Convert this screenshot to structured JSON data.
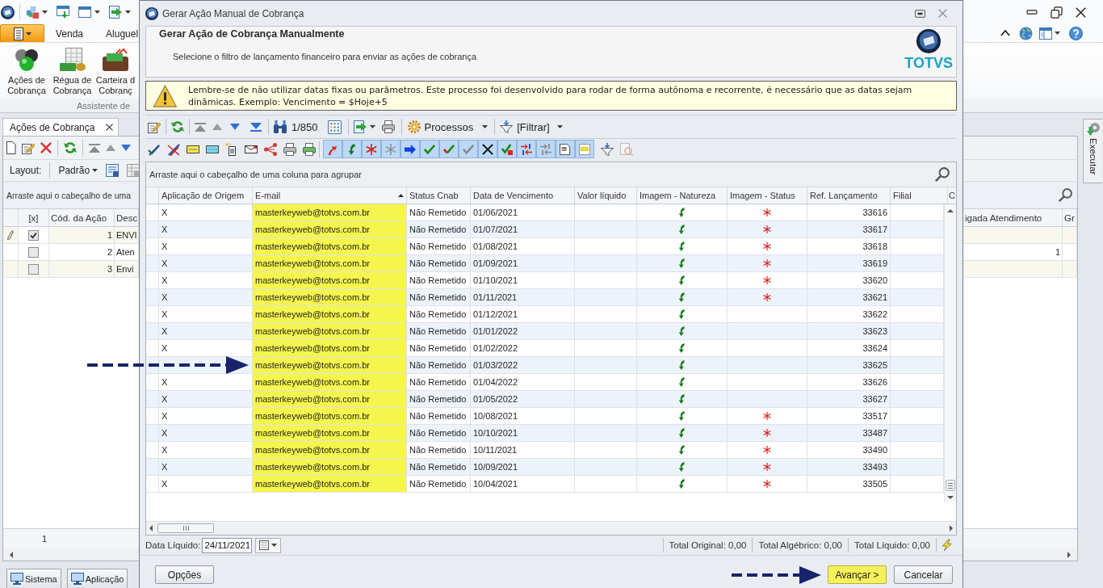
{
  "app": {
    "ribbon_tabs": [
      {
        "label": "Venda",
        "selected": false
      },
      {
        "label": "Aluguel",
        "selected": false
      }
    ],
    "ribbon_buttons": [
      {
        "lines": [
          "Ações de",
          "Cobrança"
        ]
      },
      {
        "lines": [
          "Régua de",
          "Cobrança"
        ]
      },
      {
        "lines": [
          "Carteira d",
          "Cobranç"
        ]
      }
    ],
    "ribbon_group": "Assistente de",
    "document_tabs": [
      {
        "label": "Ações de Cobrança",
        "selected": true
      }
    ],
    "layout": {
      "label": "Layout:",
      "value": "Padrão"
    },
    "grid": {
      "group_hint": "Arraste aqui o cabeçalho de uma",
      "columns": [
        "[x]",
        "Cód. da Ação",
        "Desc",
        "igada Atendimento",
        "Gr"
      ],
      "rows": [
        {
          "focused": true,
          "checked": true,
          "code": "1",
          "description": "ENVI"
        },
        {
          "focused": false,
          "checked": false,
          "code": "2",
          "description": "Aten",
          "coligada": "1"
        },
        {
          "focused": false,
          "checked": false,
          "code": "3",
          "description": "Envi"
        }
      ],
      "footer_count": "1"
    },
    "side_tab": "Executar",
    "taskbar": [
      {
        "label": "Sistema"
      },
      {
        "label": "Aplicação"
      }
    ]
  },
  "dialog": {
    "title": "Gerar Ação Manual de Cobrança",
    "heading": "Gerar Ação de Cobrança Manualmente",
    "subheading": "Selecione o filtro de lançamento financeiro para enviar as ações de cobrança",
    "logo_text": "TOTVS",
    "warning": "Lembre-se de não utilizar datas fixas ou parâmetros. Este processo foi desenvolvido para rodar de forma autônoma e recorrente, é necessário que as datas sejam dinâmicas. Exemplo: Vencimento = $Hoje+5",
    "toolbar": {
      "record_position": "1/850",
      "processes": "Processos",
      "filter": "[Filtrar]"
    },
    "status_filters": [
      {
        "on": true
      },
      {
        "on": true
      },
      {
        "on": true
      },
      {
        "on": true
      },
      {
        "on": true
      },
      {
        "on": true
      },
      {
        "on": true
      },
      {
        "on": true
      },
      {
        "on": true
      },
      {
        "on": true
      },
      {
        "on": true
      },
      {
        "on": true
      },
      {
        "on": true
      },
      {
        "on": true
      }
    ],
    "grid": {
      "group_hint": "Arraste aqui o cabeçalho de uma coluna para agrupar",
      "columns": [
        {
          "label": "Aplicação de Origem",
          "sorted": false,
          "highlighted": false
        },
        {
          "label": "E-mail",
          "sorted": true,
          "highlighted": true
        },
        {
          "label": "Status Cnab",
          "sorted": false,
          "highlighted": false
        },
        {
          "label": "Data de Vencimento",
          "sorted": false,
          "highlighted": false
        },
        {
          "label": "Valor líquido",
          "sorted": false,
          "highlighted": false
        },
        {
          "label": "Imagem - Natureza",
          "sorted": false,
          "highlighted": false
        },
        {
          "label": "Imagem - Status",
          "sorted": false,
          "highlighted": false
        },
        {
          "label": "Ref. Lançamento",
          "sorted": false,
          "highlighted": false
        },
        {
          "label": "Filial",
          "sorted": false,
          "highlighted": false
        },
        {
          "label": "C",
          "sorted": false,
          "highlighted": false
        }
      ],
      "rows": [
        {
          "origin": "X",
          "email": "masterkeyweb@totvs.com.br",
          "cnab_status": "Não Remetido",
          "due_date": "01/06/2021",
          "reference": "33616",
          "status_flag": true
        },
        {
          "origin": "X",
          "email": "masterkeyweb@totvs.com.br",
          "cnab_status": "Não Remetido",
          "due_date": "01/07/2021",
          "reference": "33617",
          "status_flag": true
        },
        {
          "origin": "X",
          "email": "masterkeyweb@totvs.com.br",
          "cnab_status": "Não Remetido",
          "due_date": "01/08/2021",
          "reference": "33618",
          "status_flag": true
        },
        {
          "origin": "X",
          "email": "masterkeyweb@totvs.com.br",
          "cnab_status": "Não Remetido",
          "due_date": "01/09/2021",
          "reference": "33619",
          "status_flag": true
        },
        {
          "origin": "X",
          "email": "masterkeyweb@totvs.com.br",
          "cnab_status": "Não Remetido",
          "due_date": "01/10/2021",
          "reference": "33620",
          "status_flag": true
        },
        {
          "origin": "X",
          "email": "masterkeyweb@totvs.com.br",
          "cnab_status": "Não Remetido",
          "due_date": "01/11/2021",
          "reference": "33621",
          "status_flag": true
        },
        {
          "origin": "X",
          "email": "masterkeyweb@totvs.com.br",
          "cnab_status": "Não Remetido",
          "due_date": "01/12/2021",
          "reference": "33622",
          "status_flag": false
        },
        {
          "origin": "X",
          "email": "masterkeyweb@totvs.com.br",
          "cnab_status": "Não Remetido",
          "due_date": "01/01/2022",
          "reference": "33623",
          "status_flag": false
        },
        {
          "origin": "X",
          "email": "masterkeyweb@totvs.com.br",
          "cnab_status": "Não Remetido",
          "due_date": "01/02/2022",
          "reference": "33624",
          "status_flag": false
        },
        {
          "email": "masterkeyweb@totvs.com.br",
          "cnab_status": "Não Remetido",
          "due_date": "01/03/2022",
          "reference": "33625",
          "status_flag": false
        },
        {
          "origin": "X",
          "email": "masterkeyweb@totvs.com.br",
          "cnab_status": "Não Remetido",
          "due_date": "01/04/2022",
          "reference": "33626",
          "status_flag": false
        },
        {
          "origin": "X",
          "email": "masterkeyweb@totvs.com.br",
          "cnab_status": "Não Remetido",
          "due_date": "01/05/2022",
          "reference": "33627",
          "status_flag": false
        },
        {
          "origin": "X",
          "email": "masterkeyweb@totvs.com.br",
          "cnab_status": "Não Remetido",
          "due_date": "10/08/2021",
          "reference": "33517",
          "status_flag": true
        },
        {
          "origin": "X",
          "email": "masterkeyweb@totvs.com.br",
          "cnab_status": "Não Remetido",
          "due_date": "10/10/2021",
          "reference": "33487",
          "status_flag": true
        },
        {
          "origin": "X",
          "email": "masterkeyweb@totvs.com.br",
          "cnab_status": "Não Remetido",
          "due_date": "10/11/2021",
          "reference": "33490",
          "status_flag": true
        },
        {
          "origin": "X",
          "email": "masterkeyweb@totvs.com.br",
          "cnab_status": "Não Remetido",
          "due_date": "10/09/2021",
          "reference": "33493",
          "status_flag": true
        },
        {
          "origin": "X",
          "email": "masterkeyweb@totvs.com.br",
          "cnab_status": "Não Remetido",
          "due_date": "10/04/2021",
          "reference": "33505",
          "status_flag": true
        }
      ]
    },
    "footer": {
      "date_label": "Data Líquido:",
      "date_value": "24/11/2021",
      "totals": [
        "Total Original: 0,00",
        "Total Algébrico: 0,00",
        "Total Líquido: 0,00"
      ]
    },
    "buttons": [
      {
        "label": "Opções",
        "highlighted": false
      },
      {
        "label": "Avançar >",
        "highlighted": true
      },
      {
        "label": "Cancelar",
        "highlighted": false
      }
    ]
  }
}
